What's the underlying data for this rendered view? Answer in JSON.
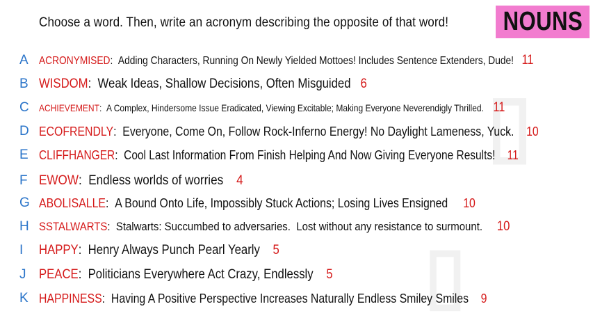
{
  "prompt": "Choose a word. Then, write an acronym describing the opposite of that word!",
  "badge": "NOUNS",
  "rows": [
    {
      "letter": "A",
      "word": "ACRONYMISED",
      "definition": "Adding Characters, Running On Newly Yielded Mottoes! Includes Sentence Extenders, Dude!",
      "count": "11"
    },
    {
      "letter": "B",
      "word": "WISDOM",
      "definition": "Weak Ideas, Shallow Decisions, Often Misguided",
      "count": "6"
    },
    {
      "letter": "C",
      "word": "ACHIEVEMENT",
      "definition": "A Complex, Hindersome Issue Eradicated, Viewing Excitable; Making Everyone Neverendigly Thrilled.",
      "count": "11"
    },
    {
      "letter": "D",
      "word": "ECOFRENDLY",
      "definition": "Everyone, Come On, Follow Rock-Inferno Energy! No Daylight Lameness, Yuck.",
      "count": "10"
    },
    {
      "letter": "E",
      "word": "CLIFFHANGER",
      "definition": "Cool Last Information From Finish Helping And Now Giving Everyone Results!",
      "count": "11"
    },
    {
      "letter": "F",
      "word": "EWOW",
      "definition": "Endless worlds of worries",
      "count": "4"
    },
    {
      "letter": "G",
      "word": "ABOLISALLE",
      "definition": "A Bound Onto Life, Impossibly Stuck Actions; Losing Lives Ensigned",
      "count": "10"
    },
    {
      "letter": "H",
      "word": "SSTALWARTS",
      "definition": "Stalwarts: Succumbed to adversaries.  Lost without any resistance to surmount.",
      "count": "10"
    },
    {
      "letter": "I",
      "word": "HAPPY",
      "definition": "Henry Always Punch Pearl Yearly",
      "count": "5"
    },
    {
      "letter": "J",
      "word": "PEACE",
      "definition": "Politicians Everywhere Act Crazy, Endlessly",
      "count": "5"
    },
    {
      "letter": "K",
      "word": "HAPPINESS",
      "definition": "Having A Positive Perspective Increases Naturally Endless Smiley Smiles",
      "count": "9"
    }
  ]
}
